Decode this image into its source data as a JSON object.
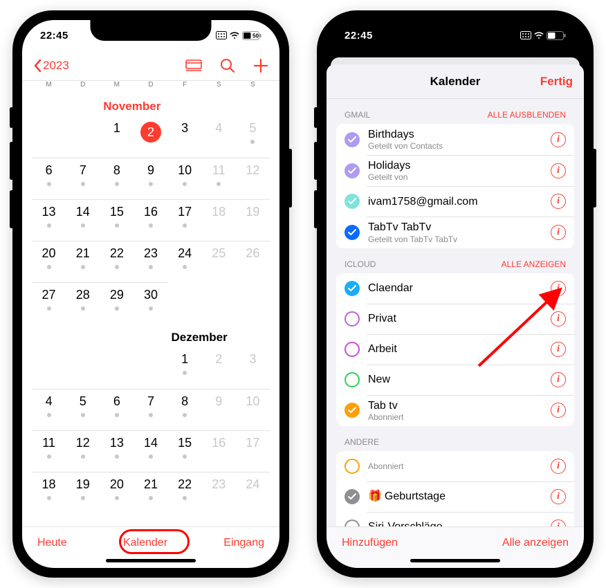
{
  "status": {
    "time": "22:45",
    "battery": "50"
  },
  "colors": {
    "accent": "#ff3b30"
  },
  "left": {
    "nav": {
      "back_label": "2023"
    },
    "weekdays": [
      "M",
      "D",
      "M",
      "D",
      "F",
      "S",
      "S"
    ],
    "month1": {
      "name": "November",
      "leading_blanks": 2,
      "days": [
        {
          "n": 1,
          "dot": false
        },
        {
          "n": 2,
          "dot": false,
          "today": true
        },
        {
          "n": 3,
          "dot": false
        },
        {
          "n": 4,
          "dot": false,
          "weekend": true
        },
        {
          "n": 5,
          "dot": true,
          "weekend": true
        },
        {
          "n": 6,
          "dot": true
        },
        {
          "n": 7,
          "dot": true
        },
        {
          "n": 8,
          "dot": true
        },
        {
          "n": 9,
          "dot": true
        },
        {
          "n": 10,
          "dot": true
        },
        {
          "n": 11,
          "dot": true,
          "weekend": true
        },
        {
          "n": 12,
          "dot": false,
          "weekend": true
        },
        {
          "n": 13,
          "dot": true
        },
        {
          "n": 14,
          "dot": true
        },
        {
          "n": 15,
          "dot": true
        },
        {
          "n": 16,
          "dot": true
        },
        {
          "n": 17,
          "dot": true
        },
        {
          "n": 18,
          "dot": false,
          "weekend": true
        },
        {
          "n": 19,
          "dot": false,
          "weekend": true
        },
        {
          "n": 20,
          "dot": true
        },
        {
          "n": 21,
          "dot": true
        },
        {
          "n": 22,
          "dot": true
        },
        {
          "n": 23,
          "dot": true
        },
        {
          "n": 24,
          "dot": true
        },
        {
          "n": 25,
          "dot": false,
          "weekend": true
        },
        {
          "n": 26,
          "dot": false,
          "weekend": true
        },
        {
          "n": 27,
          "dot": true
        },
        {
          "n": 28,
          "dot": true
        },
        {
          "n": 29,
          "dot": true
        },
        {
          "n": 30,
          "dot": true
        }
      ]
    },
    "month2": {
      "name": "Dezember",
      "leading_blanks": 4,
      "days": [
        {
          "n": 1,
          "dot": true
        },
        {
          "n": 2,
          "dot": false,
          "weekend": true
        },
        {
          "n": 3,
          "dot": false,
          "weekend": true
        },
        {
          "n": 4,
          "dot": true
        },
        {
          "n": 5,
          "dot": true
        },
        {
          "n": 6,
          "dot": true
        },
        {
          "n": 7,
          "dot": true
        },
        {
          "n": 8,
          "dot": true
        },
        {
          "n": 9,
          "dot": false,
          "weekend": true
        },
        {
          "n": 10,
          "dot": false,
          "weekend": true
        },
        {
          "n": 11,
          "dot": true
        },
        {
          "n": 12,
          "dot": true
        },
        {
          "n": 13,
          "dot": true
        },
        {
          "n": 14,
          "dot": true
        },
        {
          "n": 15,
          "dot": true
        },
        {
          "n": 16,
          "dot": false,
          "weekend": true
        },
        {
          "n": 17,
          "dot": false,
          "weekend": true
        },
        {
          "n": 18,
          "dot": true
        },
        {
          "n": 19,
          "dot": true
        },
        {
          "n": 20,
          "dot": true
        },
        {
          "n": 21,
          "dot": true
        },
        {
          "n": 22,
          "dot": true
        },
        {
          "n": 23,
          "dot": false,
          "weekend": true
        },
        {
          "n": 24,
          "dot": false,
          "weekend": true
        }
      ]
    },
    "toolbar": {
      "today": "Heute",
      "calendars": "Kalender",
      "inbox": "Eingang"
    }
  },
  "right": {
    "sheet": {
      "title": "Kalender",
      "done": "Fertig"
    },
    "sections": [
      {
        "header": "GMAIL",
        "action": "ALLE AUSBLENDEN",
        "rows": [
          {
            "title": "Birthdays",
            "sub": "Geteilt von Contacts",
            "checked": true,
            "color": "#af9cf0"
          },
          {
            "title": "Holidays",
            "sub": "Geteilt von",
            "checked": true,
            "color": "#af9cf0"
          },
          {
            "title": "ivam1758@gmail.com",
            "sub": "",
            "checked": true,
            "color": "#7fe3db"
          },
          {
            "title": "TabTv TabTv",
            "sub": "Geteilt von TabTv TabTv",
            "checked": true,
            "color": "#0a6cff"
          }
        ]
      },
      {
        "header": "ICLOUD",
        "action": "ALLE ANZEIGEN",
        "rows": [
          {
            "title": "Claendar",
            "sub": "",
            "checked": true,
            "color": "#1badf8"
          },
          {
            "title": "Privat",
            "sub": "",
            "checked": false,
            "color": "#c062d6"
          },
          {
            "title": "Arbeit",
            "sub": "",
            "checked": false,
            "color": "#cf4ad9"
          },
          {
            "title": "New",
            "sub": "",
            "checked": false,
            "color": "#2fd159"
          },
          {
            "title": "Tab tv",
            "sub": "Abonniert",
            "checked": true,
            "color": "#ff9f0a"
          }
        ]
      },
      {
        "header": "ANDERE",
        "action": "",
        "rows": [
          {
            "title": "",
            "sub": "Abonniert",
            "checked": false,
            "color": "#ff9f0a"
          },
          {
            "title": "Geburtstage",
            "sub": "",
            "checked": true,
            "color": "#8e8e93",
            "gift": true
          },
          {
            "title": "Siri-Vorschläge",
            "sub": "",
            "checked": false,
            "color": "#8e8e93"
          }
        ]
      }
    ],
    "toolbar": {
      "add": "Hinzufügen",
      "show_all": "Alle anzeigen"
    }
  }
}
